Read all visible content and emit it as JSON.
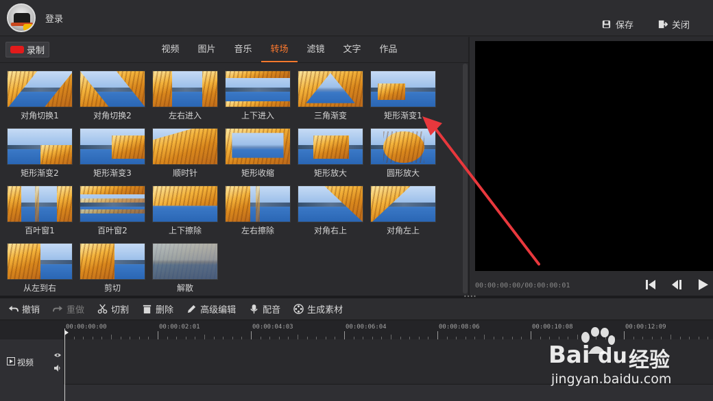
{
  "header": {
    "login": "登录",
    "save": "保存",
    "close": "关闭"
  },
  "record_button": "录制",
  "tabs": [
    "视频",
    "图片",
    "音乐",
    "转场",
    "滤镜",
    "文字",
    "作品"
  ],
  "active_tab": "转场",
  "transitions": [
    "对角切换1",
    "对角切换2",
    "左右进入",
    "上下进入",
    "三角渐变",
    "矩形渐变1",
    "矩形渐变2",
    "矩形渐变3",
    "顺时针",
    "矩形收缩",
    "矩形放大",
    "圆形放大",
    "百叶窗1",
    "百叶窗2",
    "上下擦除",
    "左右擦除",
    "对角右上",
    "对角左上",
    "从左到右",
    "剪切",
    "解散"
  ],
  "preview": {
    "timecode": "00:00:00:00/00:00:00:01"
  },
  "toolbar": {
    "undo": "撤销",
    "redo": "重做",
    "cut": "切割",
    "delete": "删除",
    "advanced_edit": "高级编辑",
    "dub": "配音",
    "generate": "生成素材"
  },
  "timeline": {
    "ruler_labels": [
      "00:00:00:00",
      "00:00:02:01",
      "00:00:04:03",
      "00:00:06:04",
      "00:00:08:06",
      "00:00:10:08",
      "00:00:12:09"
    ],
    "track_video": "视频"
  },
  "watermark": {
    "brand": "Bai",
    "brand2": "du",
    "cn": "经验",
    "url": "jingyan.baidu.com"
  },
  "colors": {
    "accent": "#ff7a2e",
    "arrow": "#e8383d",
    "record": "#e21b1b"
  }
}
